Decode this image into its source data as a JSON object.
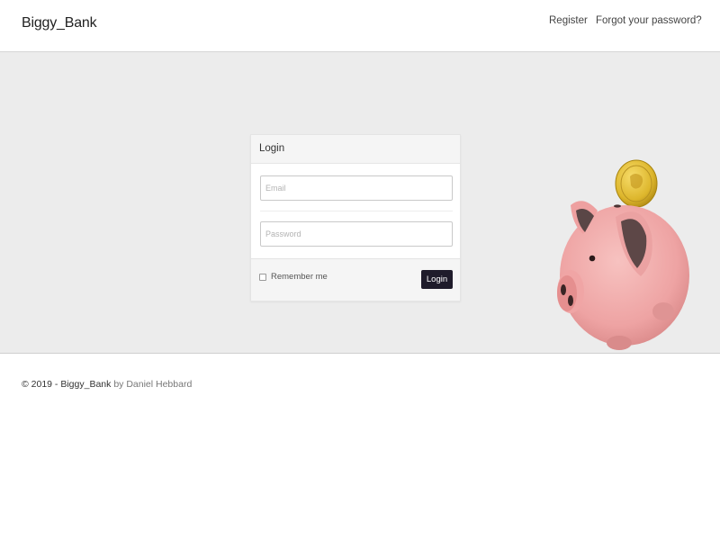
{
  "navbar": {
    "brand": "Biggy_Bank",
    "links": [
      {
        "label": "Register"
      },
      {
        "label": "Forgot your password?"
      }
    ]
  },
  "login_panel": {
    "heading": "Login",
    "email": {
      "value": "",
      "placeholder": "Email"
    },
    "password": {
      "value": "",
      "placeholder": "Password"
    },
    "remember_label": "Remember me",
    "remember_checked": false,
    "submit_label": "Login"
  },
  "footer": {
    "copyright": "© 2019 - Biggy_Bank",
    "by_text": "by Daniel Hebbard"
  },
  "colors": {
    "hero_background": "#ececec",
    "button_background": "#1f1c2b",
    "pig_pink": "#f0a8a8",
    "coin_gold": "#e8c23a"
  },
  "icons": {
    "illustration": "piggy-bank-with-coin"
  }
}
